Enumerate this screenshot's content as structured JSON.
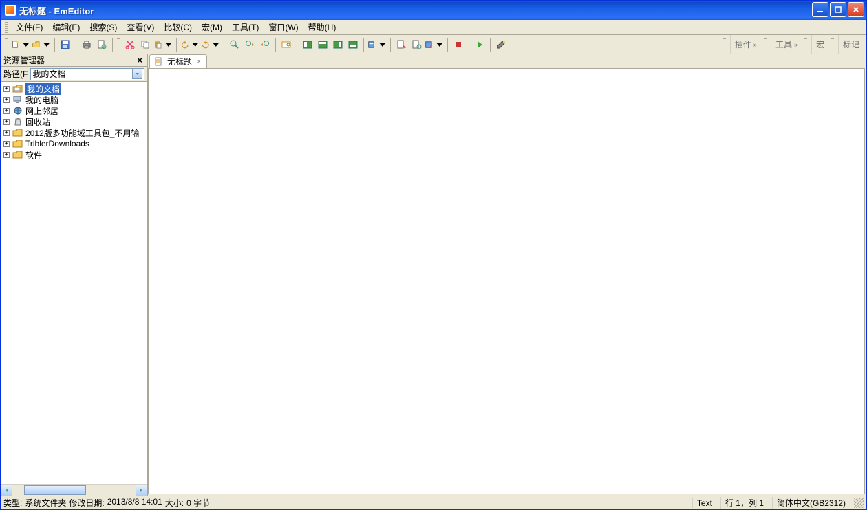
{
  "title": "无标题 - EmEditor",
  "menu": {
    "file": "文件(F)",
    "edit": "编辑(E)",
    "search": "搜索(S)",
    "view": "查看(V)",
    "compare": "比较(C)",
    "macro": "宏(M)",
    "tools": "工具(T)",
    "window": "窗口(W)",
    "help": "帮助(H)"
  },
  "right_segs": {
    "plugins": "插件",
    "tools": "工具",
    "macro": "宏",
    "mark": "标记"
  },
  "explorer": {
    "title": "资源管理器",
    "path_label": "路径(F",
    "path_value": "我的文档",
    "items": [
      {
        "label": "我的文档",
        "icon": "folder-docs",
        "selected": true
      },
      {
        "label": "我的电脑",
        "icon": "computer",
        "selected": false
      },
      {
        "label": "网上邻居",
        "icon": "network",
        "selected": false
      },
      {
        "label": "回收站",
        "icon": "recycle",
        "selected": false
      },
      {
        "label": "2012版多功能域工具包_不用输",
        "icon": "folder",
        "selected": false
      },
      {
        "label": "TriblerDownloads",
        "icon": "folder",
        "selected": false
      },
      {
        "label": "软件",
        "icon": "folder",
        "selected": false
      }
    ]
  },
  "tab": {
    "label": "无标题"
  },
  "status": {
    "type_label": "类型:",
    "type_value": "系统文件夹",
    "mod_label": "修改日期:",
    "mod_value": "2013/8/8 14:01",
    "size_label": "大小:",
    "size_value": "0 字节",
    "mode": "Text",
    "position": "行 1，列 1",
    "encoding": "简体中文(GB2312)"
  }
}
